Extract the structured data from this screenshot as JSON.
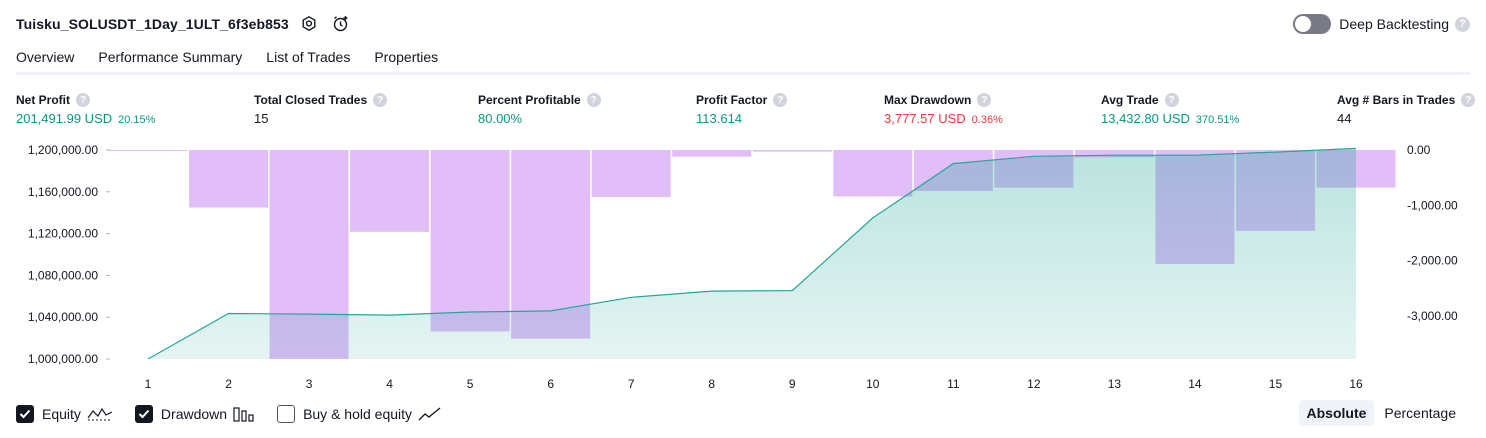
{
  "header": {
    "strategy_name": "Tuisku_SOLUSDT_1Day_1ULT_6f3eb853",
    "settings_icon": "settings-gear-icon",
    "alert_icon": "add-alert-icon",
    "deep_backtesting_label": "Deep Backtesting",
    "deep_backtesting_enabled": false,
    "help_glyph": "?"
  },
  "tabs": [
    {
      "label": "Overview",
      "active": true
    },
    {
      "label": "Performance Summary",
      "active": false
    },
    {
      "label": "List of Trades",
      "active": false
    },
    {
      "label": "Properties",
      "active": false
    }
  ],
  "metrics": [
    {
      "label": "Net Profit",
      "value": "201,491.99 USD",
      "pct": "20.15%",
      "tone": "pos"
    },
    {
      "label": "Total Closed Trades",
      "value": "15",
      "pct": "",
      "tone": "neu"
    },
    {
      "label": "Percent Profitable",
      "value": "80.00%",
      "pct": "",
      "tone": "pos"
    },
    {
      "label": "Profit Factor",
      "value": "113.614",
      "pct": "",
      "tone": "pos"
    },
    {
      "label": "Max Drawdown",
      "value": "3,777.57 USD",
      "pct": "0.36%",
      "tone": "neg"
    },
    {
      "label": "Avg Trade",
      "value": "13,432.80 USD",
      "pct": "370.51%",
      "tone": "pos"
    },
    {
      "label": "Avg # Bars in Trades",
      "value": "44",
      "pct": "",
      "tone": "neu"
    }
  ],
  "chart_data": {
    "type": "area",
    "x": [
      1,
      2,
      3,
      4,
      5,
      6,
      7,
      8,
      9,
      10,
      11,
      12,
      13,
      14,
      15,
      16
    ],
    "left_axis_ticks": [
      "1,200,000.00",
      "1,160,000.00",
      "1,120,000.00",
      "1,080,000.00",
      "1,040,000.00",
      "1,000,000.00"
    ],
    "left_ylim": [
      1000000,
      1200000
    ],
    "right_axis_ticks": [
      "0.00",
      "-1,000.00",
      "-2,000.00",
      "-3,000.00"
    ],
    "right_ylim": [
      -3777.57,
      0
    ],
    "series": [
      {
        "name": "Equity",
        "kind": "area",
        "axis": "left",
        "color": "#26a69a",
        "values": [
          1000000,
          1043500,
          1043000,
          1042000,
          1045000,
          1046000,
          1059000,
          1065000,
          1065500,
          1135000,
          1187000,
          1194000,
          1195000,
          1195000,
          1198000,
          1201492
        ]
      },
      {
        "name": "Drawdown",
        "kind": "bar",
        "axis": "right",
        "color": "#ce93f5",
        "values": [
          -5,
          -1040,
          -3777.57,
          -1480,
          -3280,
          -3410,
          -850,
          -120,
          -30,
          -840,
          -740,
          -680,
          -130,
          -2060,
          -1460,
          -680
        ]
      }
    ],
    "grid": false,
    "legend": "bottom-left"
  },
  "legend": [
    {
      "label": "Equity",
      "checked": true,
      "icon": "equity-line-icon"
    },
    {
      "label": "Drawdown",
      "checked": true,
      "icon": "drawdown-bars-icon"
    },
    {
      "label": "Buy & hold equity",
      "checked": false,
      "icon": "buy-hold-line-icon"
    }
  ],
  "mode": {
    "absolute_label": "Absolute",
    "percentage_label": "Percentage",
    "selected": "Absolute"
  },
  "colors": {
    "positive": "#089981",
    "negative": "#f23645",
    "equity_line": "#26a69a",
    "equity_fill": "#c8ebe1",
    "drawdown_fill": "#ce93f5"
  }
}
